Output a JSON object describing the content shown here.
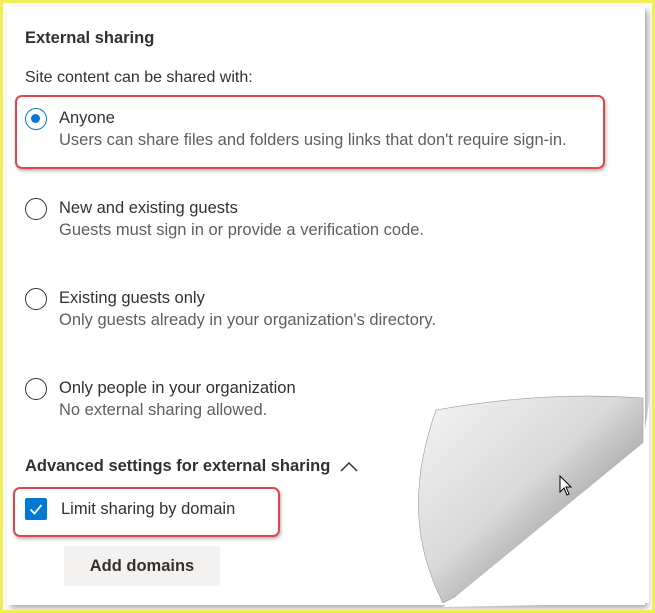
{
  "section": {
    "title": "External sharing",
    "sub_label": "Site content can be shared with:"
  },
  "options": [
    {
      "label": "Anyone",
      "desc": "Users can share files and folders using links that don't require sign-in.",
      "selected": true
    },
    {
      "label": "New and existing guests",
      "desc": "Guests must sign in or provide a verification code.",
      "selected": false
    },
    {
      "label": "Existing guests only",
      "desc": "Only guests already in your organization's directory.",
      "selected": false
    },
    {
      "label": "Only people in your organization",
      "desc": "No external sharing allowed.",
      "selected": false
    }
  ],
  "advanced": {
    "label": "Advanced settings for external sharing",
    "expanded": true,
    "limit_label": "Limit sharing by domain",
    "limit_checked": true,
    "add_button": "Add domains"
  },
  "colors": {
    "accent": "#0078d4",
    "highlight": "#e0474c",
    "frame_border": "#f2ee5a"
  }
}
